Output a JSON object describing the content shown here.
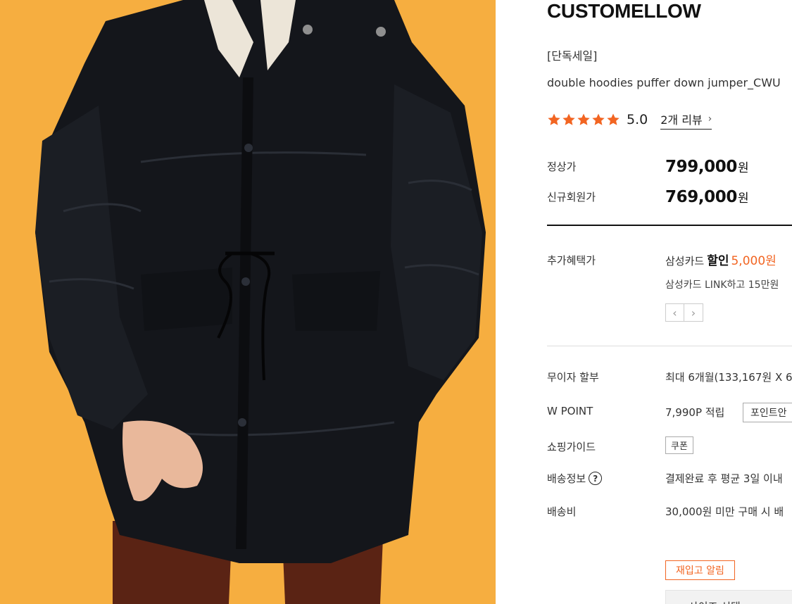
{
  "product": {
    "brand": "CUSTOMELLOW",
    "tag": "[단독세일]",
    "name": "double hoodies puffer down jumper_CWU",
    "rating": {
      "stars": 5,
      "score": "5.0",
      "review_link": "2개 리뷰",
      "chevron": "›",
      "star_color": "#f26522"
    }
  },
  "prices": {
    "regular_label": "정상가",
    "regular_value": "799,000",
    "member_label": "신규회원가",
    "member_value": "769,000",
    "currency": "원"
  },
  "benefits": {
    "label": "추가혜택가",
    "line1_prefix": "삼성카드",
    "line1_strong": "할인",
    "line1_amount": "5,000원",
    "line2": "삼성카드 LINK하고 15만원",
    "pager_prev": "‹",
    "pager_next": "›"
  },
  "details": {
    "installment_label": "무이자 할부",
    "installment_value": "최대 6개월(133,167원 X 6",
    "point_label": "W POINT",
    "point_value": "7,990P 적립",
    "point_button": "포인트안",
    "guide_label": "쇼핑가이드",
    "coupon_badge": "쿠폰",
    "shipping_label": "배송정보",
    "shipping_help_icon": "?",
    "shipping_value": "결제완료 후 평균 3일 이내",
    "fee_label": "배송비",
    "fee_value": "30,000원 미만 구매 시 배"
  },
  "actions": {
    "restock_button": "재입고 알림",
    "option_select": "사이즈 선택"
  },
  "colors": {
    "accent": "#f26522",
    "photo_background": "#f6ae40",
    "jacket": "#14161b"
  }
}
